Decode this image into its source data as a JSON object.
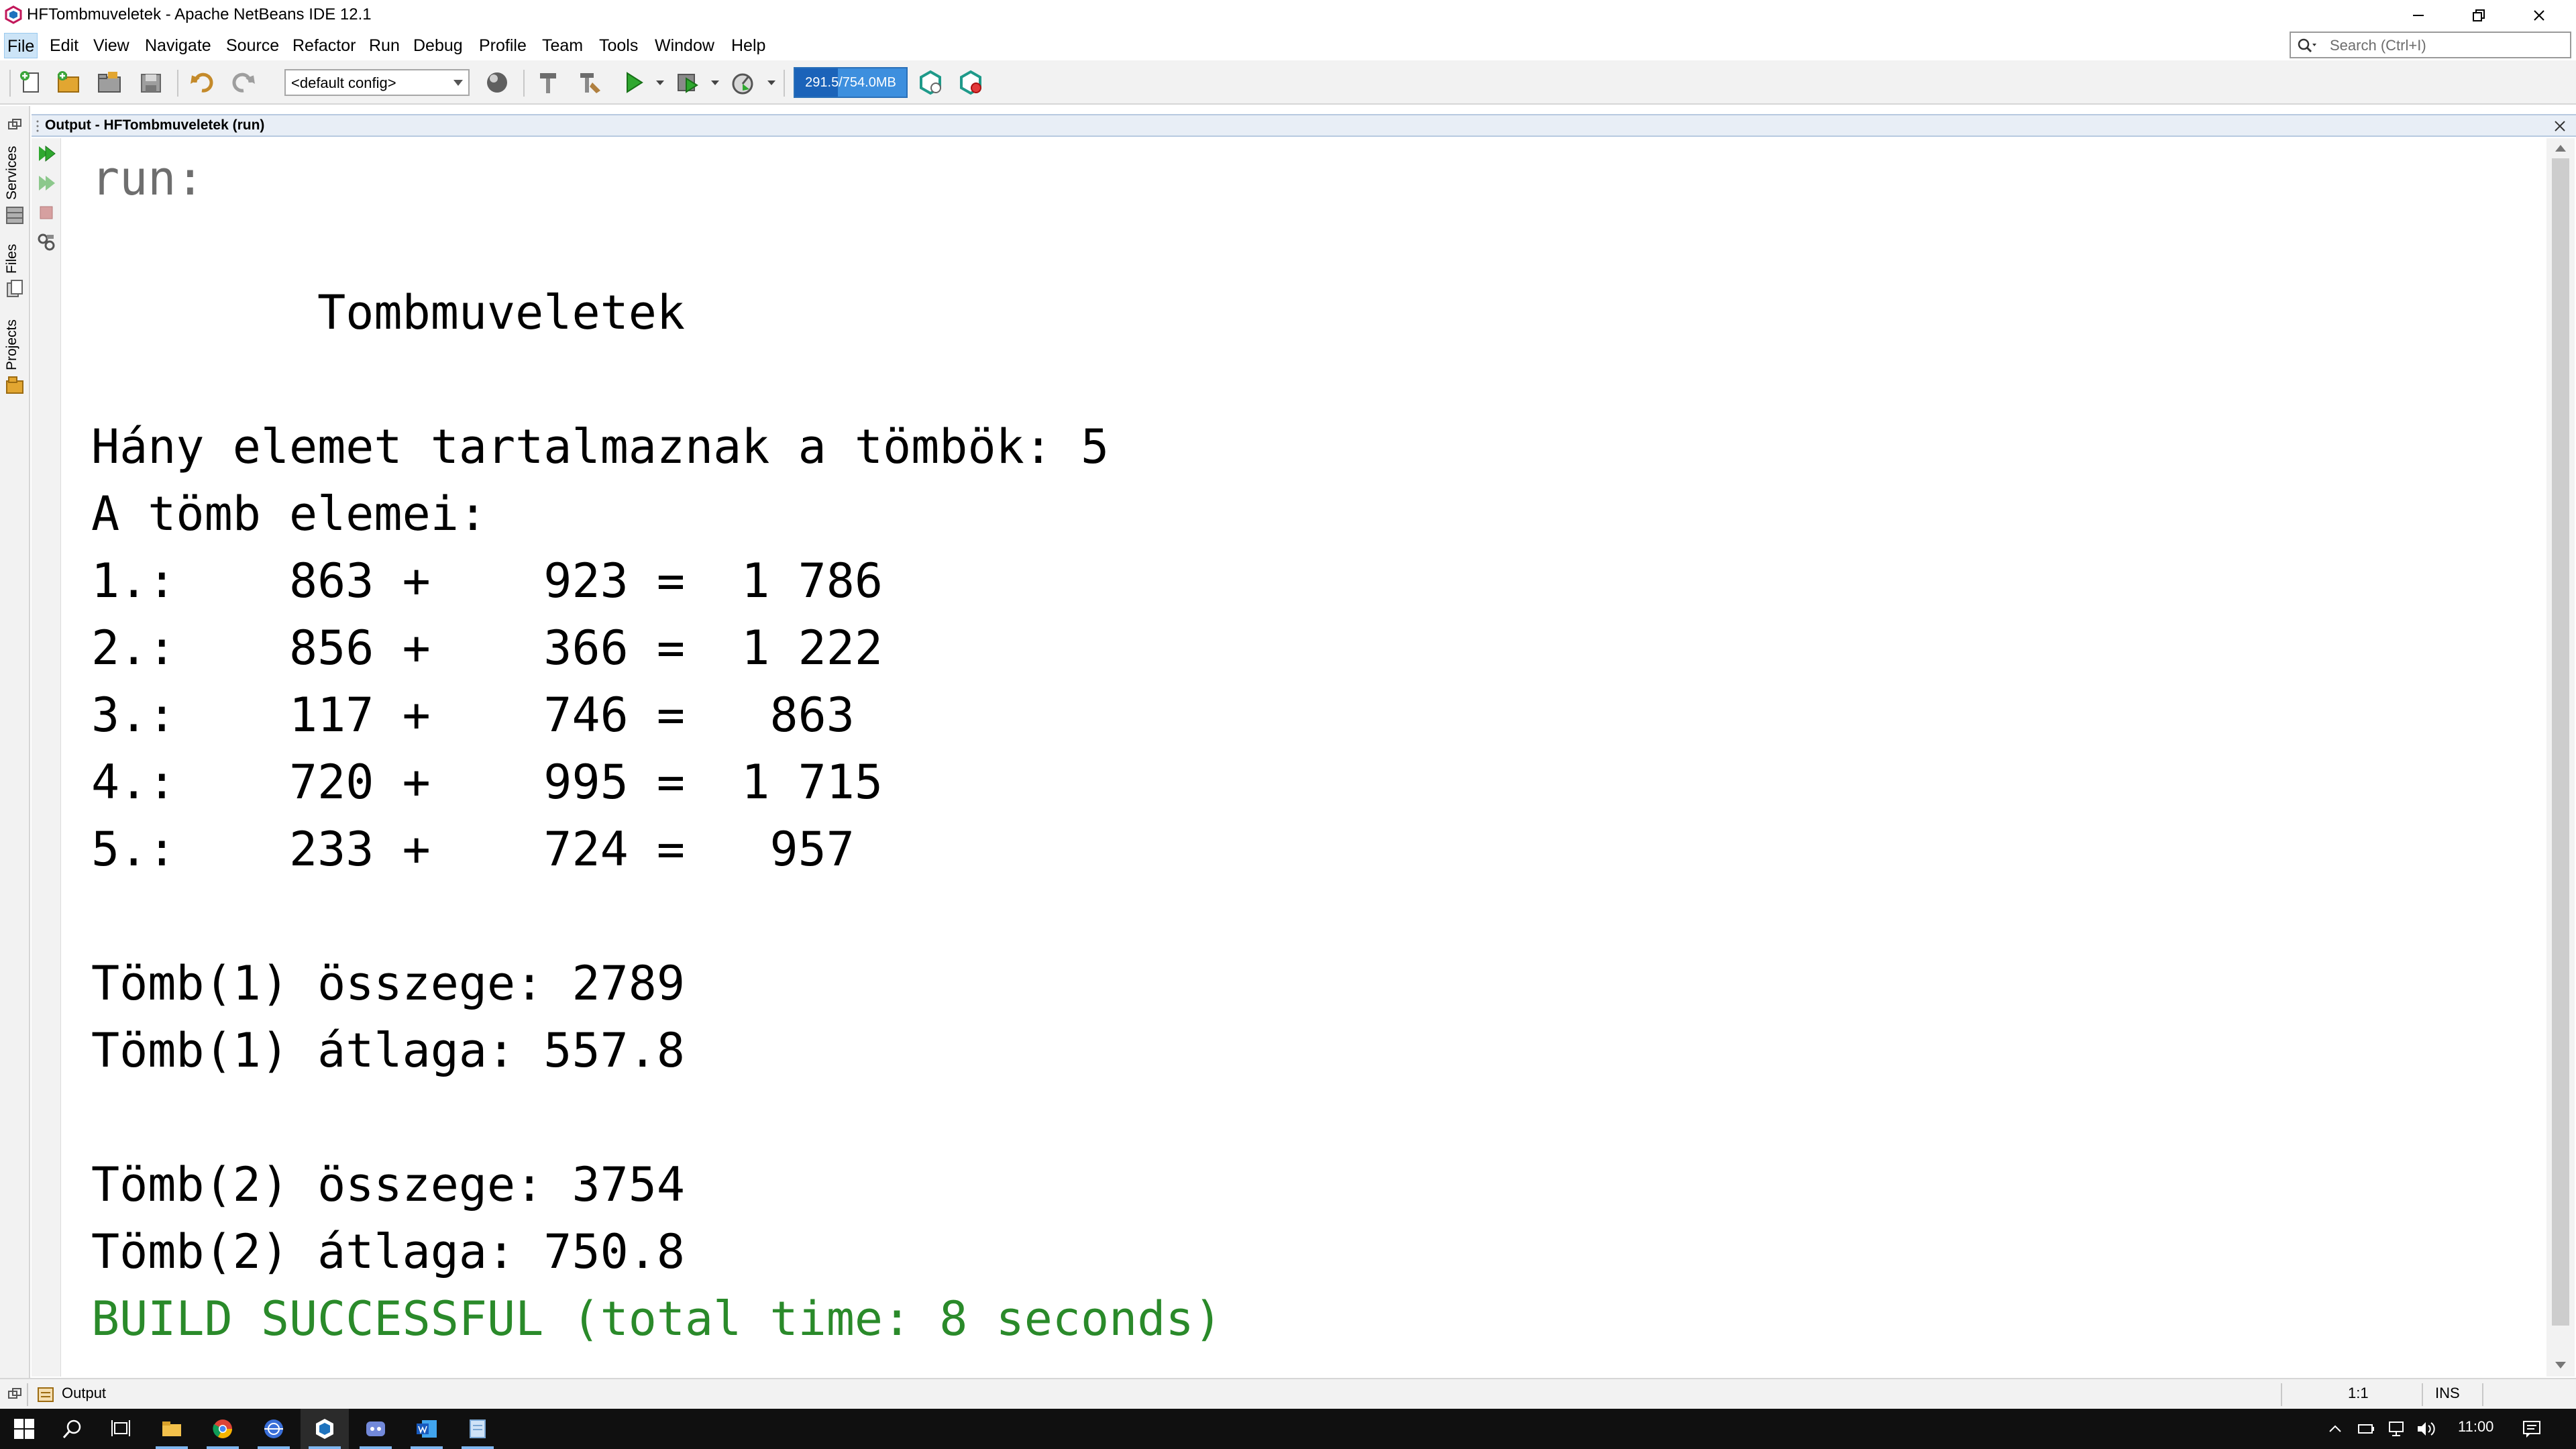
{
  "window": {
    "title": "HFTombmuveletek - Apache NetBeans IDE 12.1"
  },
  "search": {
    "placeholder": "Search (Ctrl+I)"
  },
  "menu": [
    {
      "label": "File"
    },
    {
      "label": "Edit"
    },
    {
      "label": "View"
    },
    {
      "label": "Navigate"
    },
    {
      "label": "Source"
    },
    {
      "label": "Refactor"
    },
    {
      "label": "Run"
    },
    {
      "label": "Debug"
    },
    {
      "label": "Profile"
    },
    {
      "label": "Team"
    },
    {
      "label": "Tools"
    },
    {
      "label": "Window"
    },
    {
      "label": "Help"
    }
  ],
  "toolbar": {
    "config": "<default config>",
    "memory": "291.5/754.0MB",
    "memory_fraction": 0.387
  },
  "sidebar": {
    "tabs": [
      {
        "label": "Services"
      },
      {
        "label": "Files"
      },
      {
        "label": "Projects"
      }
    ]
  },
  "output": {
    "title": "Output - HFTombmuveletek (run)",
    "lines": [
      "run:",
      "",
      "        Tombmuveletek",
      "",
      "Hány elemet tartalmaznak a tömbök: 5",
      "A tömb elemei:",
      "1.:    863 +    923 =  1 786",
      "2.:    856 +    366 =  1 222",
      "3.:    117 +    746 =   863",
      "4.:    720 +    995 =  1 715",
      "5.:    233 +    724 =   957",
      "",
      "Tömb(1) összege: 2789",
      "Tömb(1) átlaga: 557.8",
      "",
      "Tömb(2) összege: 3754",
      "Tömb(2) átlaga: 750.8",
      "BUILD SUCCESSFUL (total time: 8 seconds)"
    ]
  },
  "statusbar": {
    "tab_label": "Output",
    "position": "1:1",
    "mode": "INS"
  },
  "taskbar": {
    "time": "11:00"
  }
}
